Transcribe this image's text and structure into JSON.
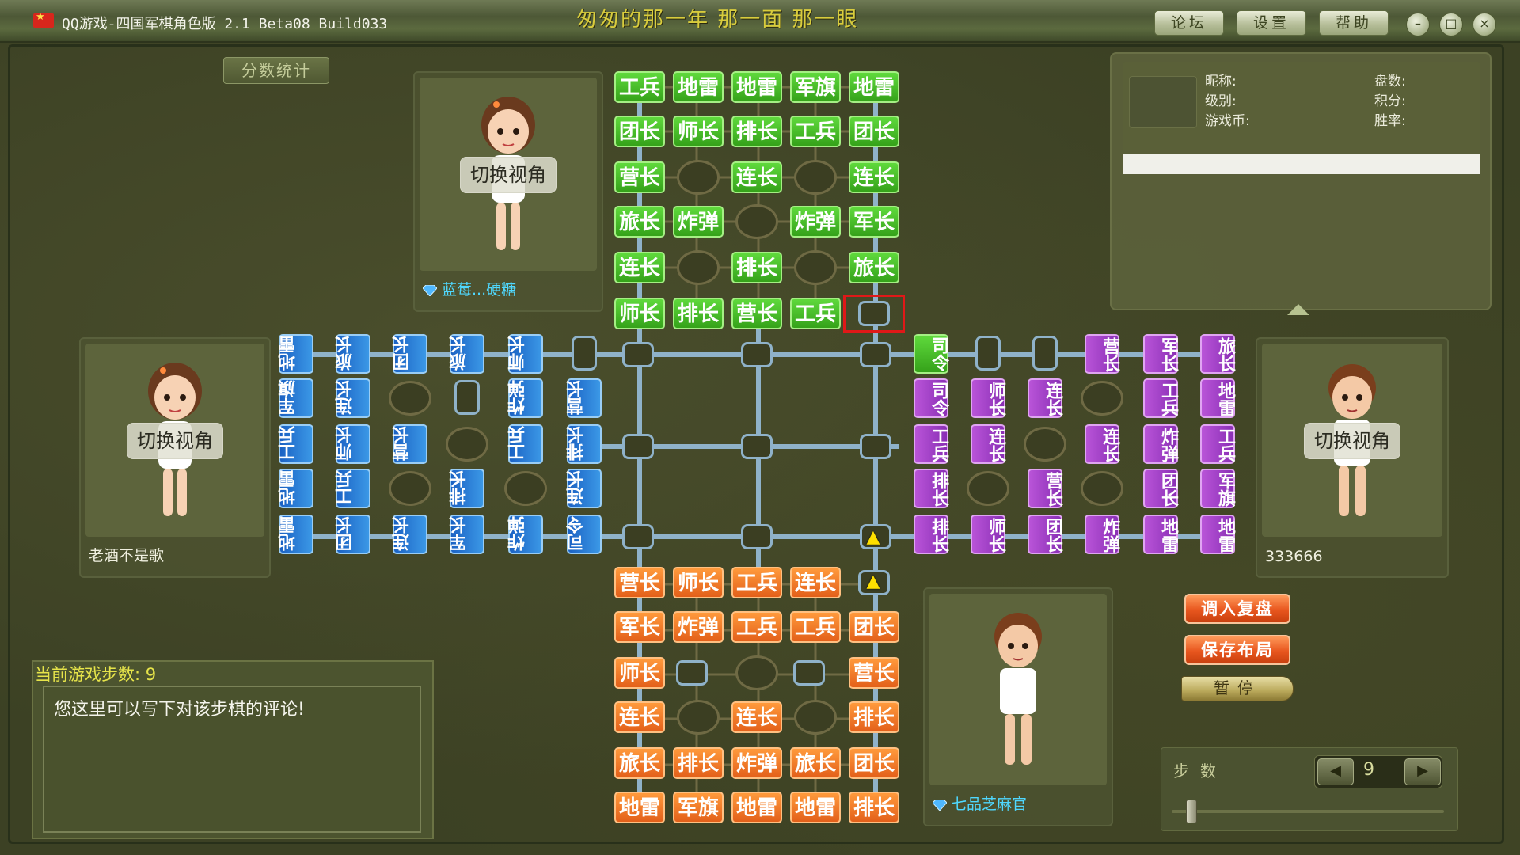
{
  "window": {
    "title": "QQ游戏-四国军棋角色版 2.1 Beta08 Build033",
    "motto": "匆匆的那一年 那一面 那一眼",
    "buttons": {
      "forum": "论坛",
      "settings": "设置",
      "help": "帮助"
    },
    "window_controls": {
      "minimize": "–",
      "maximize": "□",
      "close": "×"
    }
  },
  "score_tab": "分数统计",
  "players": {
    "top": {
      "name": "蓝莓...硬糖",
      "switch": "切换视角",
      "name_color": "#4fd8ff"
    },
    "left": {
      "name": "老酒不是歌",
      "switch": "切换视角",
      "name_color": "#f0f0e0"
    },
    "right": {
      "name": "333666",
      "switch": "切换视角",
      "name_color": "#f0f0e0"
    },
    "bottom": {
      "name": "七品芝麻官",
      "switch": "切换视角",
      "name_color": "#4fd8ff"
    }
  },
  "info": {
    "nickname": "昵称:",
    "games": "盘数:",
    "level": "级别:",
    "points": "积分:",
    "coins": "游戏币:",
    "winrate": "胜率:"
  },
  "comment": {
    "steps_label": "当前游戏步数: 9",
    "placeholder": "您这里可以写下对该步棋的评论!"
  },
  "actions": {
    "load": "调入复盘",
    "save": "保存布局",
    "pause": "暂停"
  },
  "stepper": {
    "label": "步数",
    "value": "9",
    "prev": "◀",
    "next": "▶"
  },
  "board": {
    "green_rows": [
      [
        "工兵",
        "地雷",
        "地雷",
        "军旗",
        "地雷"
      ],
      [
        "团长",
        "师长",
        "排长",
        "工兵",
        "团长"
      ],
      [
        "营长",
        "",
        "连长",
        "",
        "连长"
      ],
      [
        "旅长",
        "炸弹",
        "",
        "炸弹",
        "军长"
      ],
      [
        "连长",
        "",
        "排长",
        "",
        "旅长"
      ],
      [
        "师长",
        "排长",
        "营长",
        "工兵",
        ""
      ]
    ],
    "orange_rows": [
      [
        "营长",
        "师长",
        "工兵",
        "连长",
        ""
      ],
      [
        "军长",
        "炸弹",
        "工兵",
        "工兵",
        "团长"
      ],
      [
        "师长",
        "",
        "",
        "",
        "营长"
      ],
      [
        "连长",
        "",
        "连长",
        "",
        "排长"
      ],
      [
        "旅长",
        "排长",
        "炸弹",
        "旅长",
        "团长"
      ],
      [
        "地雷",
        "军旗",
        "地雷",
        "地雷",
        "排长"
      ]
    ],
    "blue_cols": [
      [
        "地雷",
        "军旗",
        "工兵",
        "地雷",
        "地雷"
      ],
      [
        "旅长",
        "连长",
        "师长",
        "工兵",
        "团长"
      ],
      [
        "团长",
        "",
        "营长",
        "",
        "连长"
      ],
      [
        "旅长",
        "",
        "",
        "排长",
        "军长"
      ],
      [
        "师长",
        "炸弹",
        "工兵",
        "",
        "炸弹"
      ],
      [
        "",
        "营长",
        "排长",
        "连长",
        "司令"
      ]
    ],
    "purple_cols": [
      [
        "司令",
        "司令",
        "工兵",
        "排长",
        "排长"
      ],
      [
        "",
        "师长",
        "连长",
        "",
        "师长"
      ],
      [
        "",
        "连长",
        "",
        "营长",
        "团长"
      ],
      [
        "营长",
        "",
        "连长",
        "",
        "炸弹"
      ],
      [
        "军长",
        "工兵",
        "炸弹",
        "团长",
        "地雷"
      ],
      [
        "旅长",
        "地雷",
        "工兵",
        "军旗",
        "地雷"
      ]
    ]
  }
}
